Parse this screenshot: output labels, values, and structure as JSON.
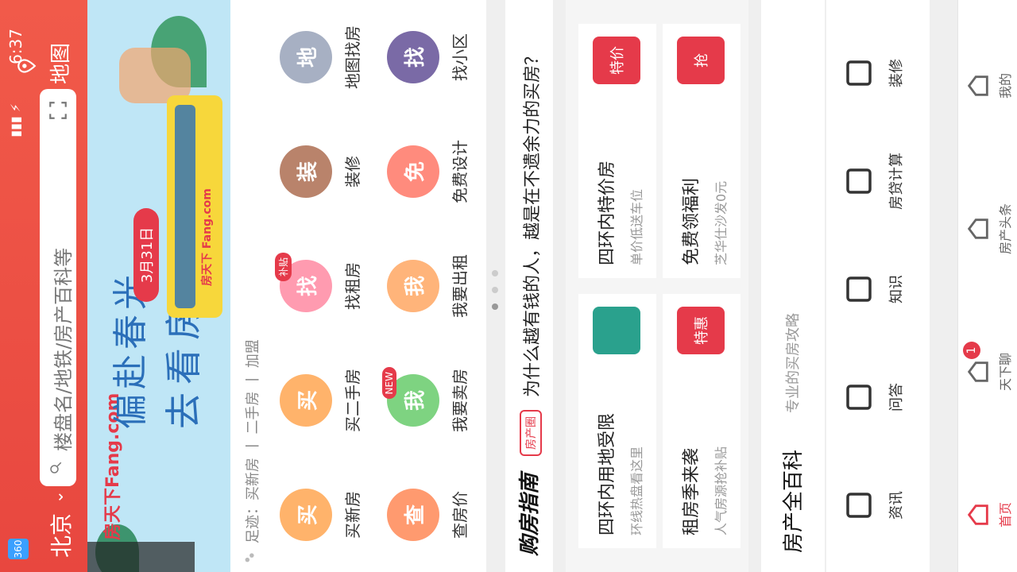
{
  "status": {
    "time": "6:37",
    "left_icon": "360"
  },
  "header": {
    "city": "北京",
    "search_placeholder": "楼盘名/地铁/房产百科等",
    "map_label": "地图"
  },
  "banner": {
    "brand": "房天下Fang.com",
    "title": "偏赴春光",
    "subtitle": "去看房",
    "date": "3月31日",
    "bus_text": "房天下 Fang.com"
  },
  "footprints": {
    "text": "足迹：买新房 丨 二手房 丨 加盟"
  },
  "grid": [
    {
      "label": "买新房",
      "icon": "tiger-icon",
      "color": "#ffb36b"
    },
    {
      "label": "买二手房",
      "icon": "tiger-icon",
      "color": "#ffb36b"
    },
    {
      "label": "找租房",
      "icon": "pig-icon",
      "color": "#ff9bb0",
      "badge": "补贴"
    },
    {
      "label": "装修",
      "icon": "cow-icon",
      "color": "#b9836b"
    },
    {
      "label": "地图找房",
      "icon": "mouse-icon",
      "color": "#a7b0c3"
    },
    {
      "label": "查房价",
      "icon": "horse-icon",
      "color": "#ff9a6f"
    },
    {
      "label": "我要卖房",
      "icon": "rabbit-icon",
      "color": "#7ed381",
      "badge": "NEW"
    },
    {
      "label": "我要出租",
      "icon": "dog-icon",
      "color": "#ffb47a"
    },
    {
      "label": "免费设计",
      "icon": "sheep-icon",
      "color": "#ff8b7d"
    },
    {
      "label": "找小区",
      "icon": "cat-icon",
      "color": "#7a6aa6"
    }
  ],
  "guide": {
    "logo": "购房指南",
    "badge": "房产圈",
    "text": "为什么越有钱的人，越是在不遗余力的买房？"
  },
  "cards": [
    {
      "title": "四环内用地受限",
      "sub": "环线热盘看这里",
      "img": "house-icon"
    },
    {
      "title": "四环内特价房",
      "sub": "单价低送车位",
      "img": "tag-icon",
      "img_text": "特价"
    },
    {
      "title": "租房季来袭",
      "sub": "人气房源抢补贴",
      "img": "ticket-icon",
      "img_text": "特惠"
    },
    {
      "title": "免费领福利",
      "sub": "芝华仕沙发0元",
      "img": "gift-icon",
      "img_text": "抢"
    }
  ],
  "baike": {
    "title": "房产全百科",
    "sub": "专业的买房攻略"
  },
  "baike_icons": [
    {
      "label": "资讯",
      "icon": "news-icon"
    },
    {
      "label": "问答",
      "icon": "qa-icon"
    },
    {
      "label": "知识",
      "icon": "book-icon"
    },
    {
      "label": "房贷计算",
      "icon": "calculator-icon"
    },
    {
      "label": "装修",
      "icon": "decor-icon"
    }
  ],
  "nav": [
    {
      "label": "首页",
      "icon": "home-icon"
    },
    {
      "label": "天下聊",
      "icon": "chat-icon",
      "badge": "1"
    },
    {
      "label": "房产头条",
      "icon": "news-icon"
    },
    {
      "label": "我的",
      "icon": "user-icon"
    }
  ],
  "colors": {
    "accent": "#e53a4a",
    "header": "#f15a4a"
  }
}
